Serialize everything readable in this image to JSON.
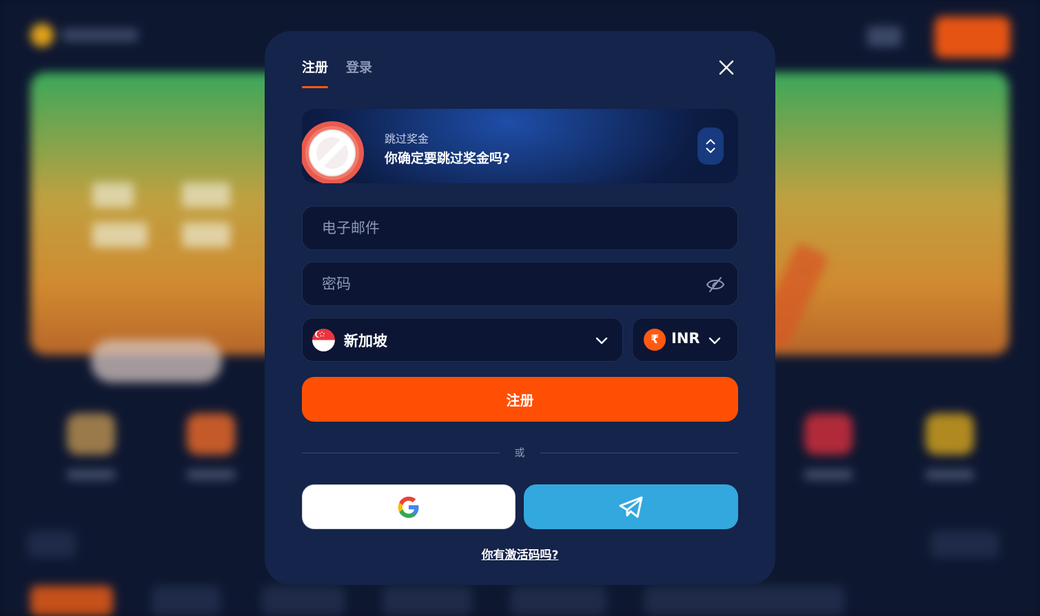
{
  "tabs": [
    {
      "label": "注册",
      "active": true
    },
    {
      "label": "登录",
      "active": false
    }
  ],
  "bonus": {
    "subtitle": "跳过奖金",
    "title": "你确定要跳过奖金吗?"
  },
  "form": {
    "email_placeholder": "电子邮件",
    "password_placeholder": "密码",
    "country": "新加坡",
    "currency_symbol": "₹",
    "currency": "INR",
    "submit_label": "注册",
    "divider_text": "或",
    "promo_link": "你有激活码吗? "
  },
  "colors": {
    "accent": "#ff4f05",
    "modal_bg": "#14244a",
    "input_bg": "#0c1634",
    "telegram": "#33a8de"
  },
  "icons": [
    "close-icon",
    "block-icon",
    "chevron-up-icon",
    "chevron-down-icon",
    "eye-off-icon",
    "singapore-flag-icon",
    "rupee-icon",
    "google-icon",
    "telegram-icon"
  ]
}
